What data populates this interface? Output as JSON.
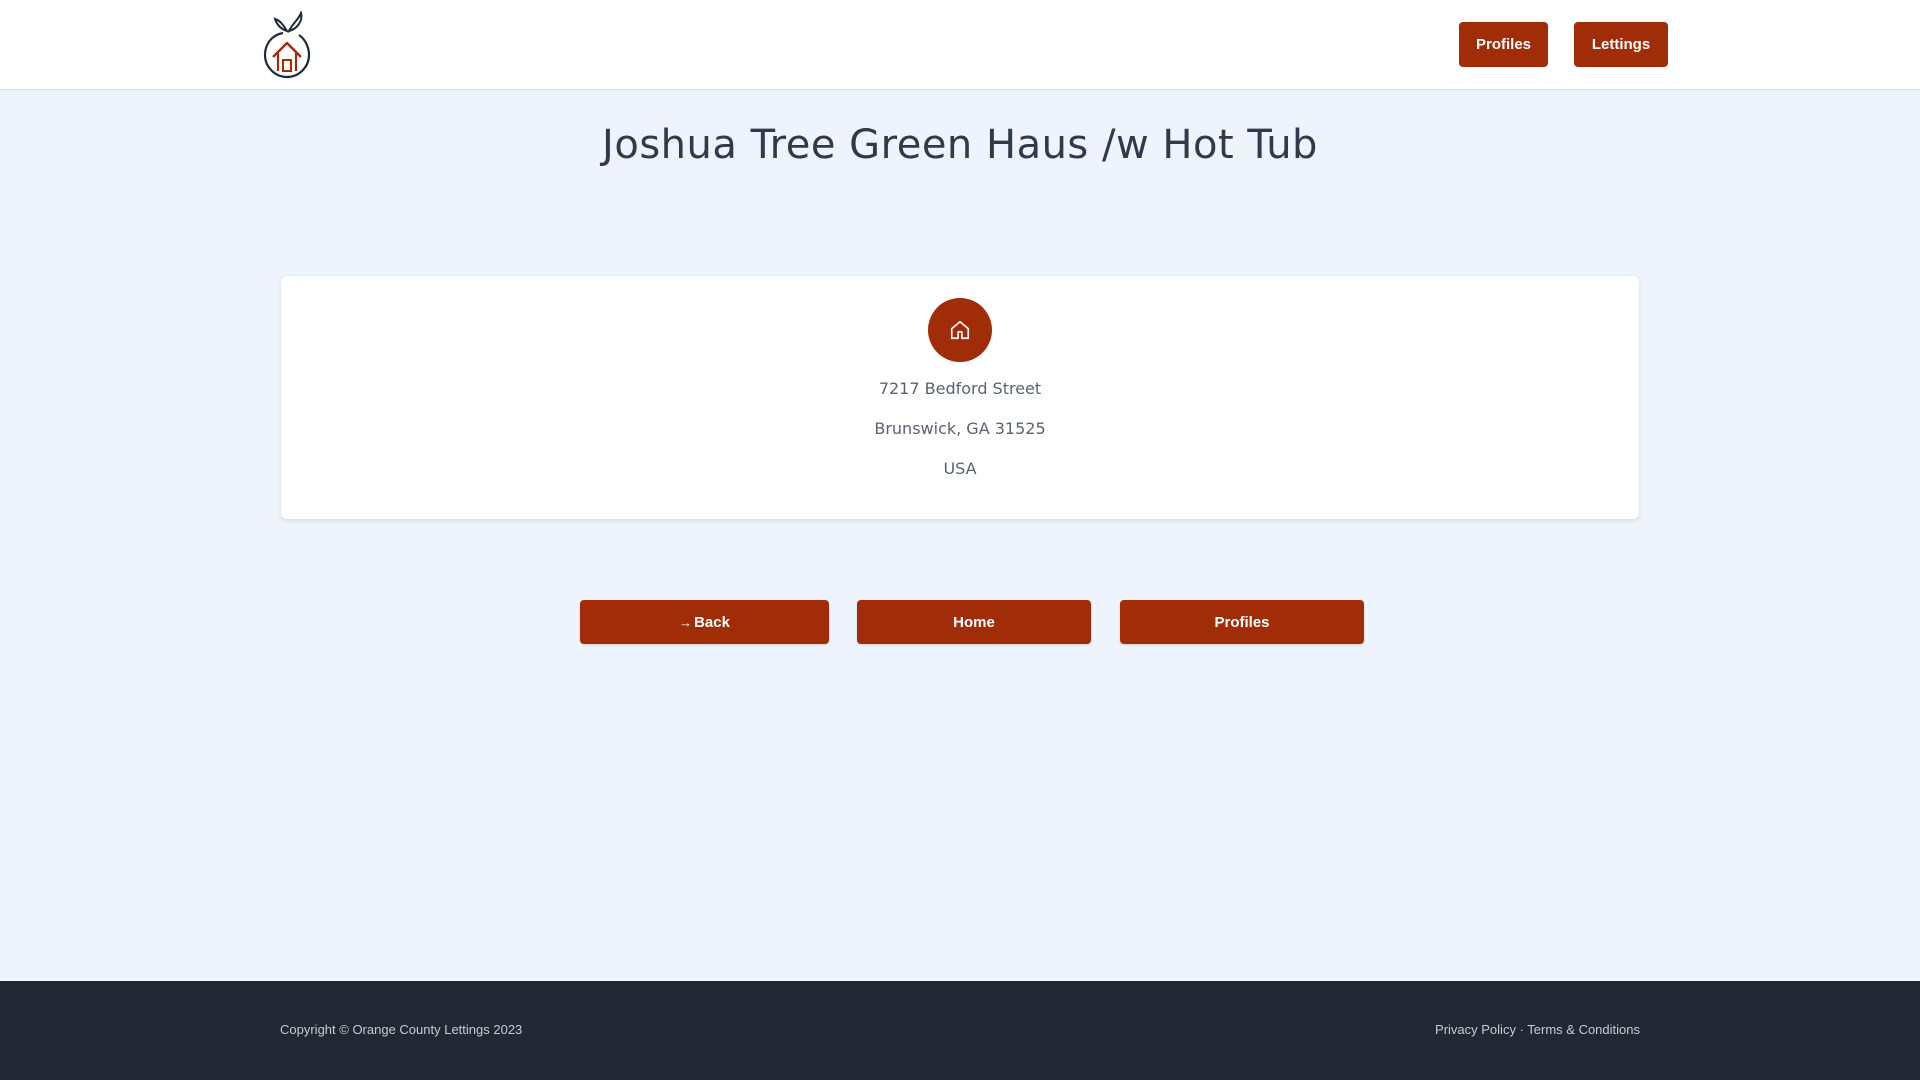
{
  "header": {
    "logo_icon": "orange-house-logo-icon",
    "nav": {
      "profiles_label": "Profiles",
      "lettings_label": "Lettings"
    }
  },
  "page": {
    "title": "Joshua Tree Green Haus /w Hot Tub"
  },
  "address_card": {
    "icon": "home-icon",
    "street": "7217 Bedford Street",
    "city_line": "Brunswick, GA 31525",
    "country": "USA"
  },
  "actions": {
    "back_label": "Back",
    "back_icon": "arrow-right-icon",
    "home_label": "Home",
    "profiles_label": "Profiles"
  },
  "footer": {
    "copyright": "Copyright © Orange County Lettings 2023",
    "privacy_label": "Privacy Policy",
    "separator": " · ",
    "terms_label": "Terms & Conditions"
  },
  "colors": {
    "accent": "#a12c08",
    "background": "#eff4fc",
    "footer_bg": "#222733"
  }
}
